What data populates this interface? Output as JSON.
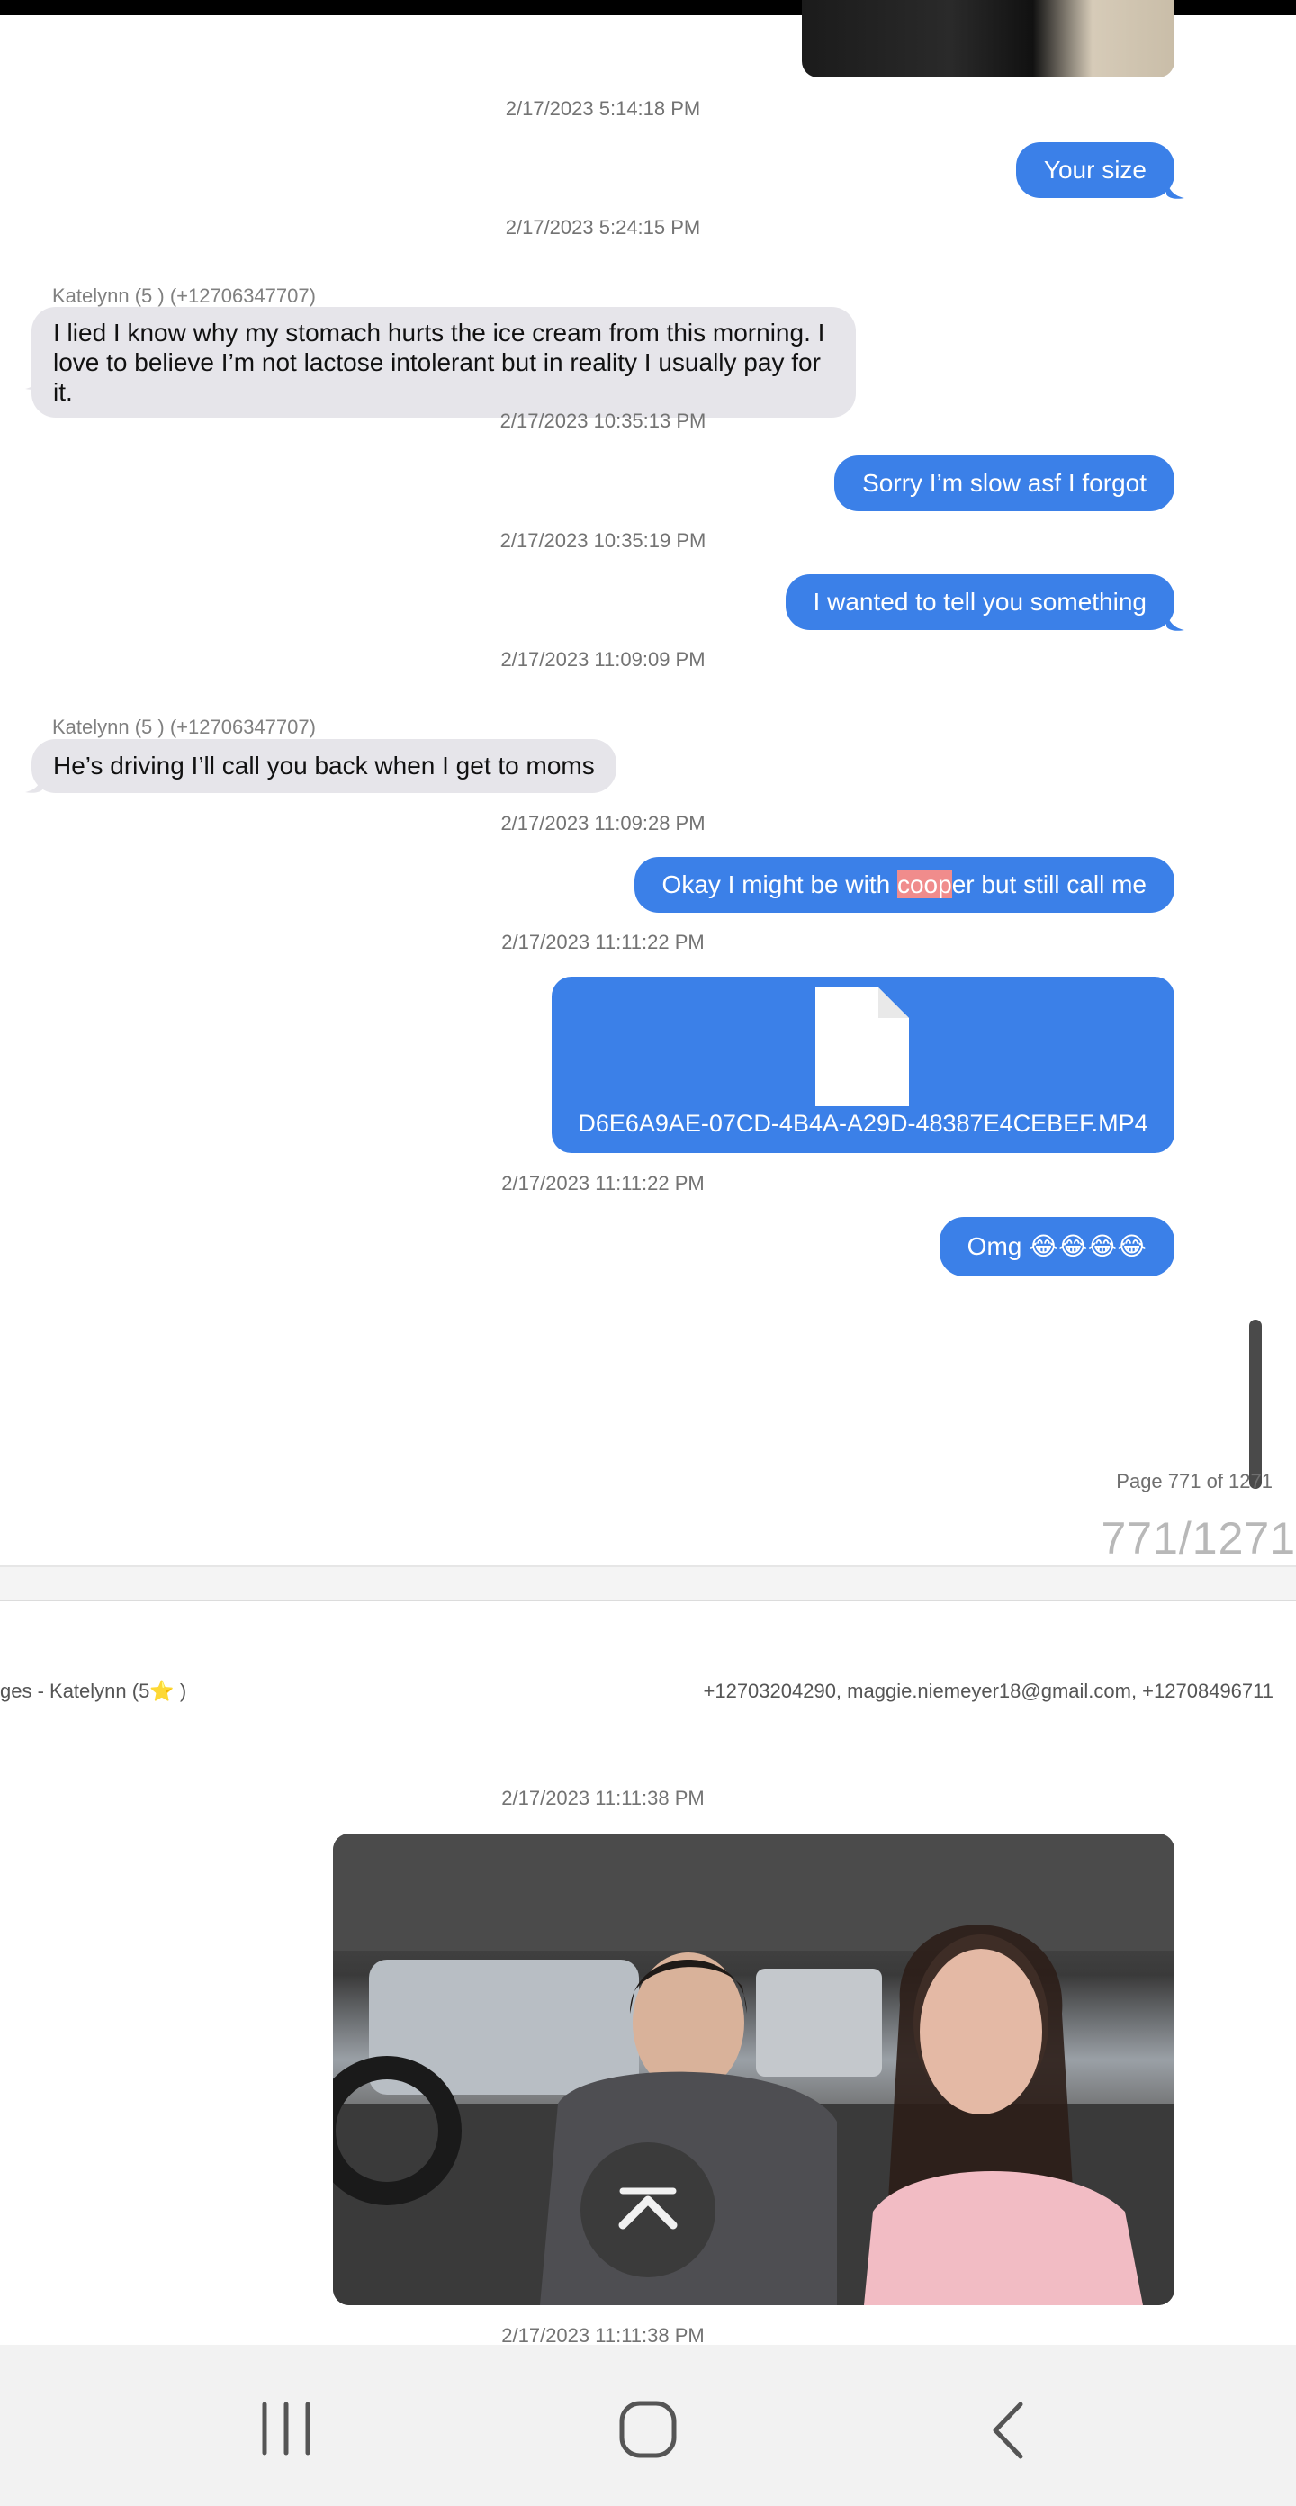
{
  "thread": {
    "messages": [
      {
        "type": "timestamp",
        "text": "2/17/2023 5:14:18 PM"
      },
      {
        "type": "outgoing",
        "text": "Your size"
      },
      {
        "type": "timestamp",
        "text": "2/17/2023 5:24:15 PM"
      },
      {
        "type": "sender",
        "text": "Katelynn (5 ) (+12706347707)"
      },
      {
        "type": "incoming",
        "lines": [
          "I lied I know why my stomach hurts the ice cream from this morning. I",
          "love to believe I’m not lactose intolerant but in reality I usually pay for it."
        ]
      },
      {
        "type": "timestamp",
        "text": "2/17/2023 10:35:13 PM"
      },
      {
        "type": "outgoing",
        "text": "Sorry I’m slow asf I forgot"
      },
      {
        "type": "timestamp",
        "text": "2/17/2023 10:35:19 PM"
      },
      {
        "type": "outgoing",
        "text": "I wanted to tell you something"
      },
      {
        "type": "timestamp",
        "text": "2/17/2023 11:09:09 PM"
      },
      {
        "type": "sender",
        "text": "Katelynn (5 ) (+12706347707)"
      },
      {
        "type": "incoming",
        "text": "He’s driving I’ll call you back when I get to moms"
      },
      {
        "type": "timestamp",
        "text": "2/17/2023 11:09:28 PM"
      },
      {
        "type": "outgoing",
        "parts": [
          "Okay I might be with ",
          "coop",
          "er but still call me"
        ]
      },
      {
        "type": "timestamp",
        "text": "2/17/2023 11:11:22 PM"
      },
      {
        "type": "attachment",
        "filename": "D6E6A9AE-07CD-4B4A-A29D-48387E4CEBEF.MP4"
      },
      {
        "type": "timestamp",
        "text": "2/17/2023 11:11:22 PM"
      },
      {
        "type": "outgoing",
        "text": "Omg 😂😂😂😂"
      }
    ]
  },
  "pager": {
    "label": "Page 771 of 1271",
    "number": "771/1271"
  },
  "next_page": {
    "header_left": "ges - Katelynn (5⭐ )",
    "header_right": "+12703204290, maggie.niemeyer18@gmail.com, +12708496711",
    "timestamp_1": "2/17/2023 11:11:38 PM",
    "timestamp_2": "2/17/2023 11:11:38 PM"
  },
  "icons": {
    "file": "file-icon",
    "scroll_top": "chevron-up-icon",
    "recents": "recent-apps-icon",
    "home": "home-icon",
    "back": "back-icon"
  },
  "colors": {
    "outgoing_bubble": "#3b80e8",
    "incoming_bubble": "#e6e5ea",
    "highlight": "#f08c8c"
  }
}
